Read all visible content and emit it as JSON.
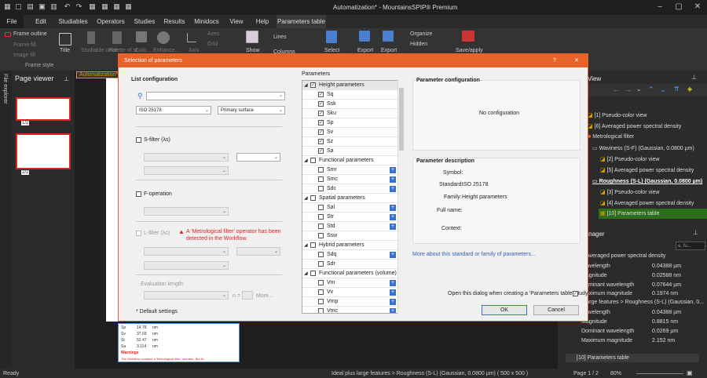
{
  "app": {
    "title": "Automatization* - MountainsSPIP® Premium"
  },
  "menu": [
    "File",
    "Edit",
    "Studiables",
    "Operators",
    "Studies",
    "Results",
    "Minidocs",
    "View",
    "Help",
    "Parameters table"
  ],
  "ribbon": {
    "frame_outline": "Frame outline",
    "frame_fill": "Frame fill",
    "image_fill": "Image fill",
    "frame_style": "Frame style",
    "title": "Title",
    "studiable_color": "Studiable color",
    "palette": "Palette of st...",
    "color": "Colo...",
    "enhance": "Enhance...",
    "axis": "Axis",
    "axes": "Axes",
    "grid": "Grid",
    "show": "Show",
    "lines": "Lines",
    "columns": "Columns",
    "select": "Select",
    "export1": "Export",
    "export2": "Export",
    "organize": "Organize",
    "hidden": "Hidden",
    "save_apply": "Save/apply"
  },
  "left": {
    "file_explorer": "File explorer",
    "page_viewer": "Page viewer",
    "page1": "1/2",
    "page2": "2/2",
    "doc_tab": "Automatization*"
  },
  "tree": {
    "view_tab": "View",
    "items": [
      "[1] Pseudo-color view",
      "[6] Averaged power spectral density",
      "Metrological filter",
      "Waviness (S-F) (Gaussian, 0.0800 µm)",
      "[2] Pseudo-color view",
      "[5] Averaged power spectral density",
      "Roughness (S-L) (Gaussian, 0.0800 µm)",
      "[3] Pseudo-color view",
      "[4] Averaged power spectral density",
      "[10] Parameters table"
    ]
  },
  "manager": {
    "title": "Manager",
    "search_placeholder": "e, fu...",
    "rows": [
      {
        "label": "Averaged power spectral density",
        "value": ""
      },
      {
        "label": "Wavelength",
        "value": "0.04388 µm"
      },
      {
        "label": "Magnitude",
        "value": "0.02588 nm"
      },
      {
        "label": "Dominant wavelength",
        "value": "0.07644 µm"
      },
      {
        "label": "Maximum magnitude",
        "value": "0.1974 nm"
      },
      {
        "label": "plus large features > Roughness (S-L) (Gaussian, 0...",
        "value": ""
      },
      {
        "label": "Wavelength",
        "value": "0.04388 µm"
      },
      {
        "label": "Magnitude",
        "value": "0.8815 nm"
      },
      {
        "label": "Dominant wavelength",
        "value": "0.0269 µm"
      },
      {
        "label": "Maximum magnitude",
        "value": "2.152 nm"
      },
      {
        "label": "[10] Parameters table",
        "value": ""
      }
    ]
  },
  "dialog": {
    "title": "Selection of parameters",
    "list_config": "List configuration",
    "search_placeholder": "",
    "standard": "ISO 25178",
    "surface": "Primary surface",
    "s_filter": "S-filter (λs)",
    "f_operation": "F-operation",
    "l_filter": "L-filter (λc)",
    "warning": "A 'Metrological filter' operator has been detected in the Workflow.",
    "eval_length": "Evaluation length:",
    "n_label": "n =",
    "more_label": "More...",
    "default_settings": "* Default settings",
    "parameters_label": "Parameters",
    "groups": [
      {
        "name": "Height parameters",
        "checked": true,
        "items": [
          {
            "name": "Sq",
            "checked": true,
            "plus": false
          },
          {
            "name": "Ssk",
            "checked": true,
            "plus": false
          },
          {
            "name": "Sku",
            "checked": true,
            "plus": false
          },
          {
            "name": "Sp",
            "checked": true,
            "plus": false
          },
          {
            "name": "Sv",
            "checked": true,
            "plus": false
          },
          {
            "name": "Sz",
            "checked": true,
            "plus": false
          },
          {
            "name": "Sa",
            "checked": true,
            "plus": false
          }
        ]
      },
      {
        "name": "Functional parameters",
        "checked": false,
        "items": [
          {
            "name": "Smr",
            "checked": false,
            "plus": true
          },
          {
            "name": "Smc",
            "checked": false,
            "plus": true
          },
          {
            "name": "Sdc",
            "checked": false,
            "plus": true
          }
        ]
      },
      {
        "name": "Spatial parameters",
        "checked": false,
        "items": [
          {
            "name": "Sal",
            "checked": false,
            "plus": true
          },
          {
            "name": "Str",
            "checked": false,
            "plus": true
          },
          {
            "name": "Std",
            "checked": false,
            "plus": true
          },
          {
            "name": "Ssw",
            "checked": false,
            "plus": false
          }
        ]
      },
      {
        "name": "Hybrid parameters",
        "checked": false,
        "items": [
          {
            "name": "Sdq",
            "checked": false,
            "plus": true
          },
          {
            "name": "Sdr",
            "checked": false,
            "plus": false
          }
        ]
      },
      {
        "name": "Functional parameters (volume)",
        "checked": false,
        "items": [
          {
            "name": "Vm",
            "checked": false,
            "plus": true
          },
          {
            "name": "Vv",
            "checked": false,
            "plus": true
          },
          {
            "name": "Vmp",
            "checked": false,
            "plus": true
          },
          {
            "name": "Vmc",
            "checked": false,
            "plus": true
          }
        ]
      }
    ],
    "param_config": "Parameter configuration",
    "no_config": "No configuration",
    "param_desc": "Parameter description",
    "symbol_label": "Symbol:",
    "symbol_value": "",
    "standard_label": "Standard:",
    "standard_value": "ISO 25178",
    "family_label": "Family:",
    "family_value": "Height parameters",
    "fullname_label": "Full name:",
    "context_label": "Context:",
    "more_about": "More about this standard or family of parameters...",
    "open_dialog": "Open this dialog when creating a 'Parameters table' study",
    "ok": "OK",
    "cancel": "Cancel",
    "help": "?",
    "close": "✕"
  },
  "doc_table": {
    "rows": [
      {
        "p": "Sp",
        "v": "14.78",
        "u": "nm"
      },
      {
        "p": "Sv",
        "v": "37.69",
        "u": "nm"
      },
      {
        "p": "St",
        "v": "52.47",
        "u": "nm"
      },
      {
        "p": "Sa",
        "v": "3.114",
        "u": "nm"
      }
    ],
    "warnings_title": "Warnings",
    "warning_text": "The Workflow contains a 'Metrological filter' operator. But th..."
  },
  "status": {
    "left": "Ready",
    "center": "Ideal plus large features > Roughness (S-L) (Gaussian, 0.0800 µm) ( 500 x 500 )",
    "page": "Page 1 / 2",
    "zoom": "80%"
  },
  "colors": {
    "accent": "#e8632a",
    "tree_highlight": "#2d6e1c",
    "link": "#3060c0"
  }
}
